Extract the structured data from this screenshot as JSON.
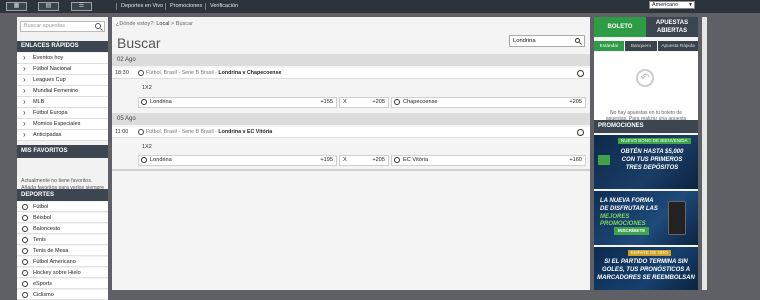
{
  "topbar": {
    "view_icons": [
      "grid-large-icon",
      "grid-small-icon",
      "list-icon"
    ],
    "links": [
      "Deportes en Vivo",
      "Promociones",
      "Verificación"
    ],
    "language": "Americano"
  },
  "sidebar": {
    "search_placeholder": "Buscar apuestas",
    "quick_links_title": "ENLACES RÁPIDOS",
    "quick_links": [
      "Eventos hoy",
      "Fútbol Nacional",
      "Leagues Cup",
      "Mundial Femenino",
      "MLB",
      "Fútbol Europa",
      "Momios Especiales",
      "Anticipadas"
    ],
    "favorites_title": "MIS FAVORITOS",
    "favorites_text": "Actualmente no tiene favoritos. Añada favoritos para verlos siempre aquí.",
    "sports_title": "DEPORTES",
    "sports": [
      "Fútbol",
      "Béisbol",
      "Baloncesto",
      "Tenis",
      "Tenis de Mesa",
      "Fútbol Americano",
      "Hockey sobre Hielo",
      "eSports",
      "Ciclismo"
    ]
  },
  "main": {
    "breadcrumb_question": "¿Dónde estoy?:",
    "breadcrumb_local": "Local",
    "breadcrumb_sep": ">",
    "breadcrumb_current": "Buscar",
    "title": "Buscar",
    "search_value": "Londrina",
    "groups": [
      {
        "date": "02 Ago",
        "time": "18:30",
        "competition": "Fútbol, Brasil - Serie B Brasil - ",
        "match": "Londrina v Chapecoense",
        "market": "1X2",
        "home": "Londrina",
        "home_odds": "+155",
        "draw": "X",
        "draw_odds": "+205",
        "away": "Chapecoense",
        "away_odds": "+205"
      },
      {
        "date": "05 Ago",
        "time": "11:00",
        "competition": "Fútbol, Brasil - Serie B Brasil - ",
        "match": "Londrina v EC Vitória",
        "market": "1X2",
        "home": "Londrina",
        "home_odds": "+195",
        "draw": "X",
        "draw_odds": "+205",
        "away": "EC Vitória",
        "away_odds": "+160"
      }
    ]
  },
  "betslip": {
    "tab_boleto": "BOLETO",
    "tab_open": "APUESTAS ABIERTAS",
    "subtabs": [
      "Estándar",
      "Banquero",
      "Apuesta Rápida"
    ],
    "empty_text": "No hay apuestas en tu boleto de apuestas. Para realizar una apuesta deportiva pulsa sobre cualquier precio",
    "promos_title": "PROMOCIONES",
    "promo1_tag": "NUEVO BONO DE BIENVENIDA",
    "promo1_line1": "OBTÉN HASTA $5,000",
    "promo1_line2": "CON TUS PRIMEROS",
    "promo1_line3": "TRES DEPÓSITOS",
    "promo2_line1": "LA NUEVA FORMA",
    "promo2_line2": "DE DISFRUTAR LAS",
    "promo2_line3": "MEJORES PROMOCIONES",
    "promo2_button": "INSCRÍBETE",
    "promo3_tag": "EMPATE DE ORO",
    "promo3_line1": "SI EL PARTIDO TERMINA SIN",
    "promo3_line2": "GOLES, TUS PRONÓSTICOS A",
    "promo3_line3": "MARCADORES SE REEMBOLSAN"
  },
  "colors": {
    "accent_green": "#3ea34a",
    "header_dark": "#3d4650",
    "tab_green": "#2e9b45"
  }
}
